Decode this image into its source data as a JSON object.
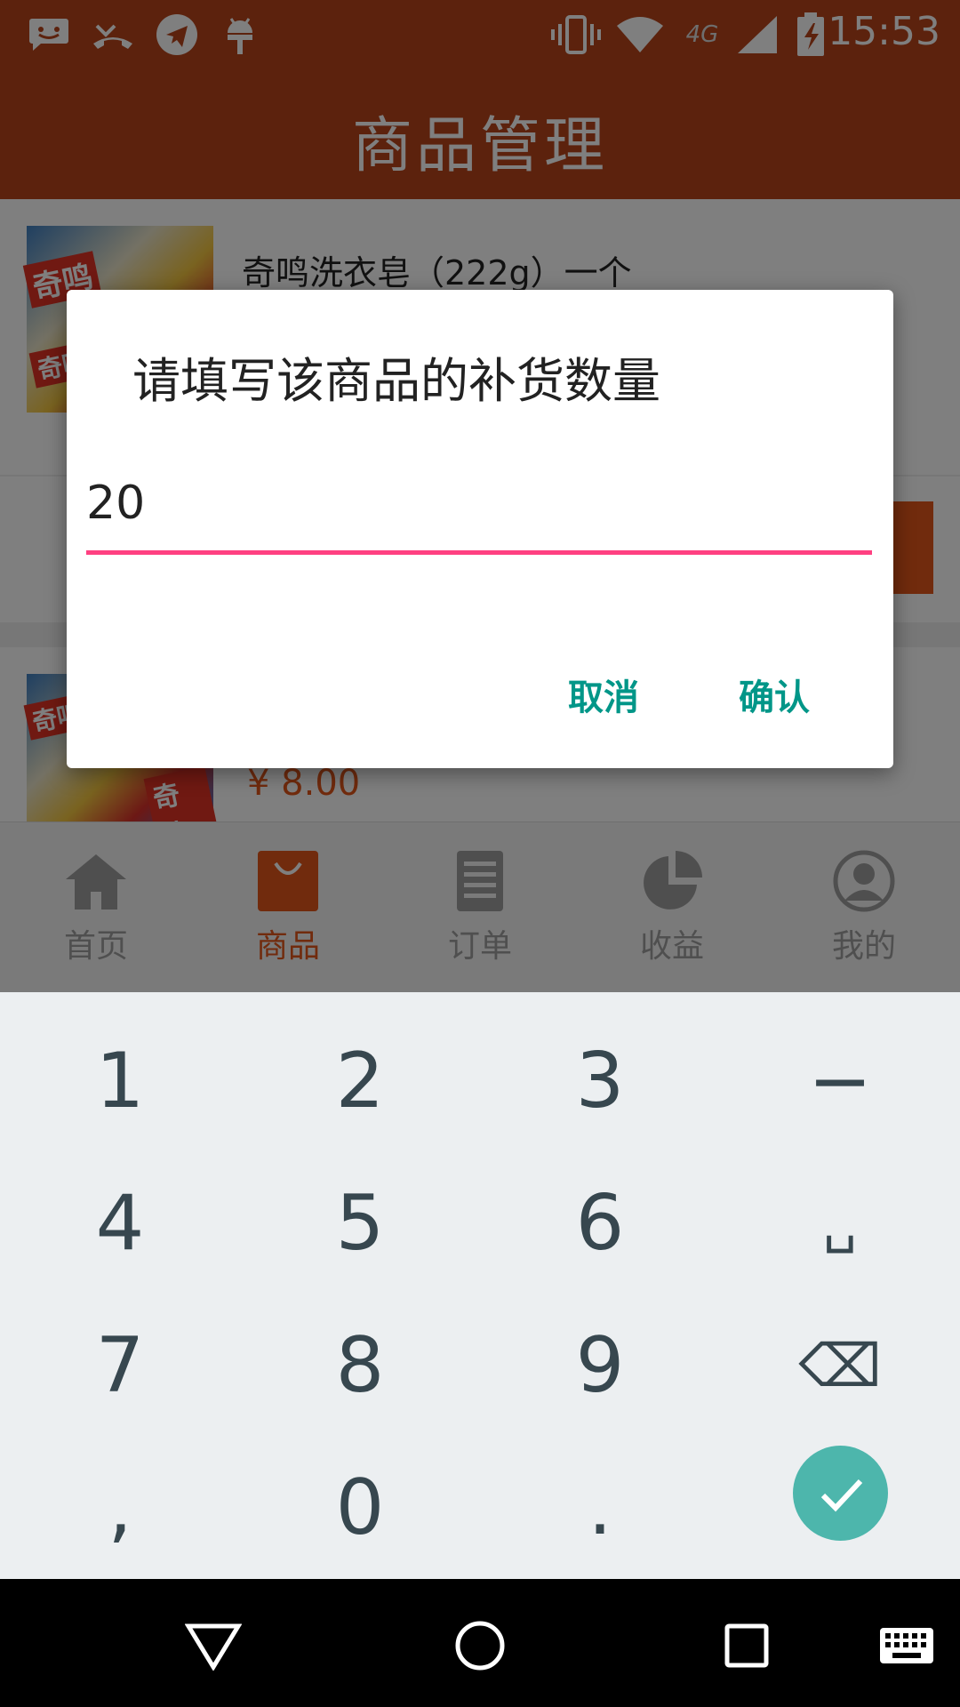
{
  "status_bar": {
    "time": "15:53",
    "network": "4G",
    "icons": [
      "message-icon",
      "missed-call-icon",
      "telegram-icon",
      "android-debug-icon",
      "vibrate-icon",
      "wifi-icon",
      "signal-icon",
      "battery-charging-icon"
    ]
  },
  "app_bar": {
    "title": "商品管理"
  },
  "products": [
    {
      "name": "奇鸣洗衣皂（222g）一个",
      "brand_text": "奇鸣"
    },
    {
      "price": "¥ 8.00",
      "brand_text": "奇鸣"
    }
  ],
  "bottom_nav": {
    "items": [
      {
        "label": "首页",
        "icon": "home-icon",
        "active": false
      },
      {
        "label": "商品",
        "icon": "shopping-bag-icon",
        "active": true
      },
      {
        "label": "订单",
        "icon": "document-icon",
        "active": false
      },
      {
        "label": "收益",
        "icon": "pie-chart-icon",
        "active": false
      },
      {
        "label": "我的",
        "icon": "profile-icon",
        "active": false
      }
    ]
  },
  "dialog": {
    "title": "请填写该商品的补货数量",
    "input_value": "20",
    "cancel_label": "取消",
    "confirm_label": "确认"
  },
  "keyboard": {
    "keys": [
      "1",
      "2",
      "3",
      "−",
      "4",
      "5",
      "6",
      "␣",
      "7",
      "8",
      "9",
      "⌫",
      ",",
      "0",
      "."
    ],
    "done": "checkmark-icon"
  },
  "system_nav": [
    "back-icon",
    "home-circle-icon",
    "recents-icon",
    "keyboard-icon"
  ],
  "colors": {
    "accent_orange": "#e2561a",
    "app_bar": "#b8441a",
    "dialog_button": "#009688",
    "input_underline": "#ff4081",
    "done_key": "#4db6ac"
  }
}
